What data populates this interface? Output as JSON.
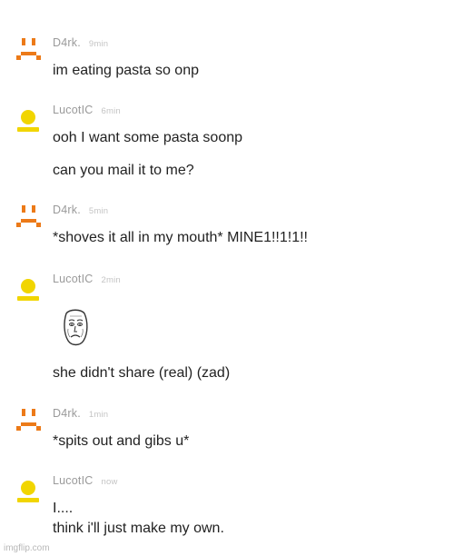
{
  "colors": {
    "d4rk_avatar": "#ec7a18",
    "lucotic_avatar": "#f1d500",
    "name_text": "#9a9a9a",
    "time_text": "#c4c4c4",
    "message_text": "#222222"
  },
  "messages": [
    {
      "author": "D4rk.",
      "time": "9min",
      "avatar_icon": "d4rk-sad-face-icon",
      "lines": [
        "im eating pasta so onp"
      ]
    },
    {
      "author": "LucotIC",
      "time": "6min",
      "avatar_icon": "yellow-person-icon",
      "lines": [
        "ooh I want some pasta soonp",
        "can you mail it to me?"
      ]
    },
    {
      "author": "D4rk.",
      "time": "5min",
      "avatar_icon": "d4rk-sad-face-icon",
      "lines": [
        "*shoves it all in my mouth* MINE1!!1!1!!"
      ]
    },
    {
      "author": "LucotIC",
      "time": "2min",
      "avatar_icon": "yellow-person-icon",
      "image": "okay-guy-meme-face",
      "lines": [
        "she didn't share (real) (zad)"
      ]
    },
    {
      "author": "D4rk.",
      "time": "1min",
      "avatar_icon": "d4rk-sad-face-icon",
      "lines": [
        "*spits out and gibs u*"
      ]
    },
    {
      "author": "LucotIC",
      "time": "now",
      "avatar_icon": "yellow-person-icon",
      "lines": [
        "I....",
        "think i'll just make my own."
      ]
    }
  ],
  "watermark": "imgflip.com"
}
